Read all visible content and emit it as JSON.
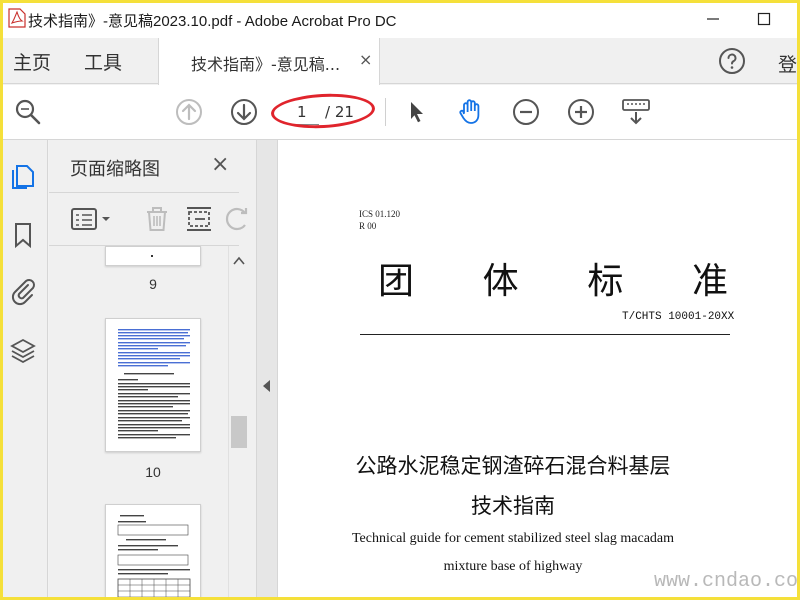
{
  "window": {
    "title": "技术指南》-意见稿2023.10.pdf - Adobe Acrobat Pro DC",
    "icon": "acrobat-pdf-icon"
  },
  "menubar": {
    "home": "主页",
    "tools": "工具",
    "doc_tab_label": "技术指南》-意见稿...",
    "doc_tab_close": "×",
    "login": "登"
  },
  "toolbar": {
    "current_page": "1",
    "total_pages": "/ 21"
  },
  "colors": {
    "accent_blue": "#1473e6",
    "annotation_red": "#e0242c",
    "frame_yellow": "#f5e03a"
  },
  "panel": {
    "title": "页面缩略图",
    "close": "×",
    "thumbnails": [
      {
        "label": "9"
      },
      {
        "label": "10"
      }
    ]
  },
  "document": {
    "ics": "ICS 01.120",
    "r_code": "R 00",
    "title_chars": [
      "团",
      "体",
      "标",
      "准"
    ],
    "standard_no": "T/CHTS 10001-20XX",
    "cn_title_line1": "公路水泥稳定钢渣碎石混合料基层",
    "cn_title_line2": "技术指南",
    "en_title_line1": "Technical guide for cement stabilized steel slag macadam",
    "en_title_line2": "mixture base of highway"
  },
  "watermark": "www.cndao.com"
}
